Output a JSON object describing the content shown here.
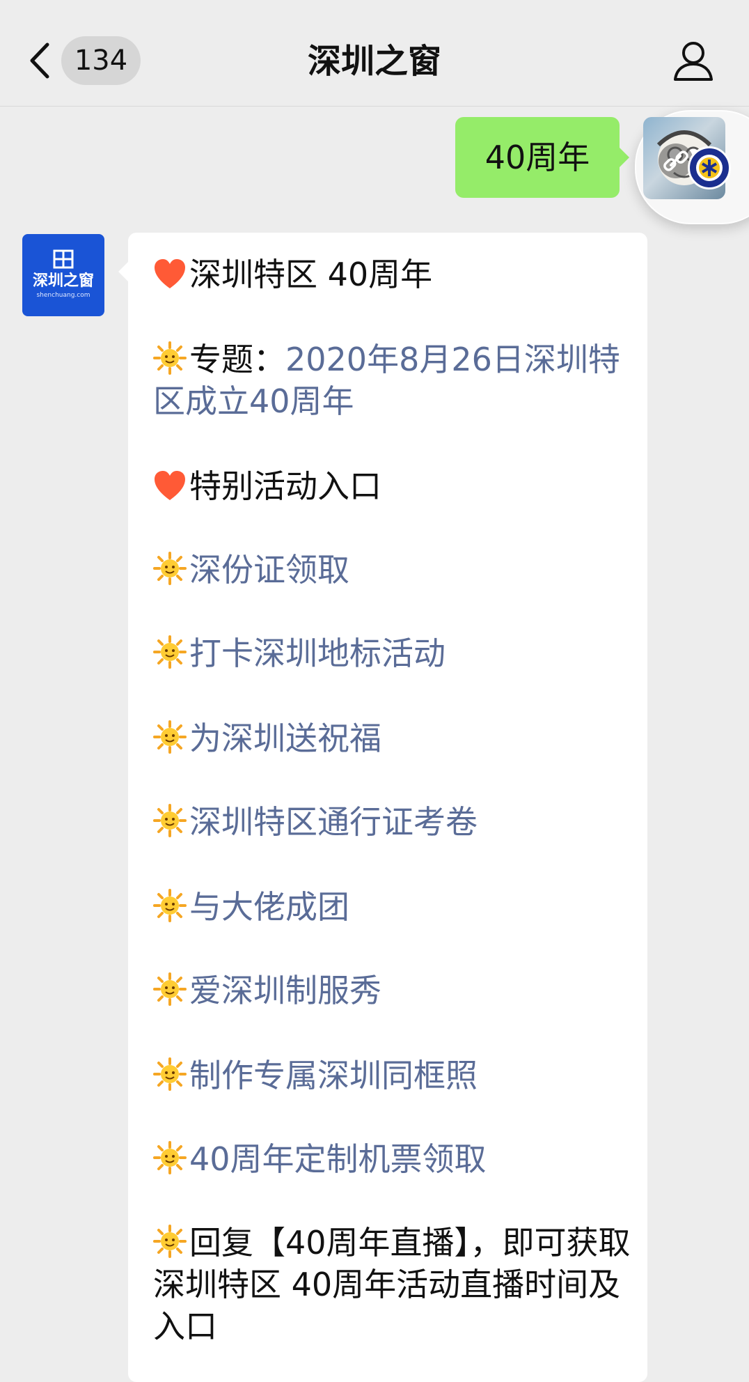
{
  "navbar": {
    "badge_count": "134",
    "title": "深圳之窗"
  },
  "outgoing": {
    "text": "40周年"
  },
  "account": {
    "logo_text": "深圳之窗",
    "logo_subtext": "shenchuang.com"
  },
  "message": {
    "line1": "深圳特区 40周年",
    "topic_label": "专题：",
    "topic_link": "2020年8月26日深圳特区成立40周年",
    "special_entry": "特别活动入口",
    "items": [
      "深份证领取",
      "打卡深圳地标活动",
      "为深圳送祝福",
      "深圳特区通行证考卷",
      "与大佬成团",
      "爱深圳制服秀",
      "制作专属深圳同框照",
      "40周年定制机票领取"
    ],
    "final_text": "回复【40周年直播】，即可获取深圳特区 40周年活动直播时间及入口"
  },
  "colors": {
    "background": "#ededed",
    "bubble_out": "#95ec69",
    "bubble_in": "#ffffff",
    "link": "#5a6c97",
    "account_blue": "#1a54d6"
  },
  "icons": {
    "heart": "heart-icon",
    "sun": "sun-icon",
    "back": "chevron-left-icon",
    "profile": "person-icon"
  }
}
